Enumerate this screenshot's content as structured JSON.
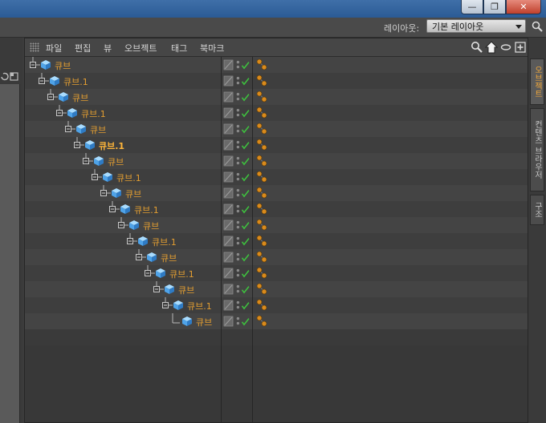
{
  "window": {
    "buttons": {
      "minimize": "—",
      "maximize": "❐",
      "close": "✕"
    }
  },
  "layout_bar": {
    "label": "레이아웃:",
    "selected": "기본 레이아웃"
  },
  "menu": {
    "items": [
      "파일",
      "편집",
      "뷰",
      "오브젝트",
      "태그",
      "북마크"
    ]
  },
  "tree": {
    "rows": [
      {
        "label": "큐브"
      },
      {
        "label": "큐브.1"
      },
      {
        "label": "큐브"
      },
      {
        "label": "큐브.1"
      },
      {
        "label": "큐브"
      },
      {
        "label": "큐브.1",
        "active": true
      },
      {
        "label": "큐브"
      },
      {
        "label": "큐브.1"
      },
      {
        "label": "큐브"
      },
      {
        "label": "큐브.1"
      },
      {
        "label": "큐브"
      },
      {
        "label": "큐브.1"
      },
      {
        "label": "큐브"
      },
      {
        "label": "큐브.1"
      },
      {
        "label": "큐브"
      },
      {
        "label": "큐브.1"
      },
      {
        "label": "큐브"
      }
    ]
  },
  "right_tabs": [
    "오브젝트",
    "컨텐츠 브라우저",
    "구조"
  ],
  "colors": {
    "accent": "#e39e31",
    "active_label": "#ffb63a",
    "cube": "#4fa3e8",
    "check": "#3ec23e"
  }
}
